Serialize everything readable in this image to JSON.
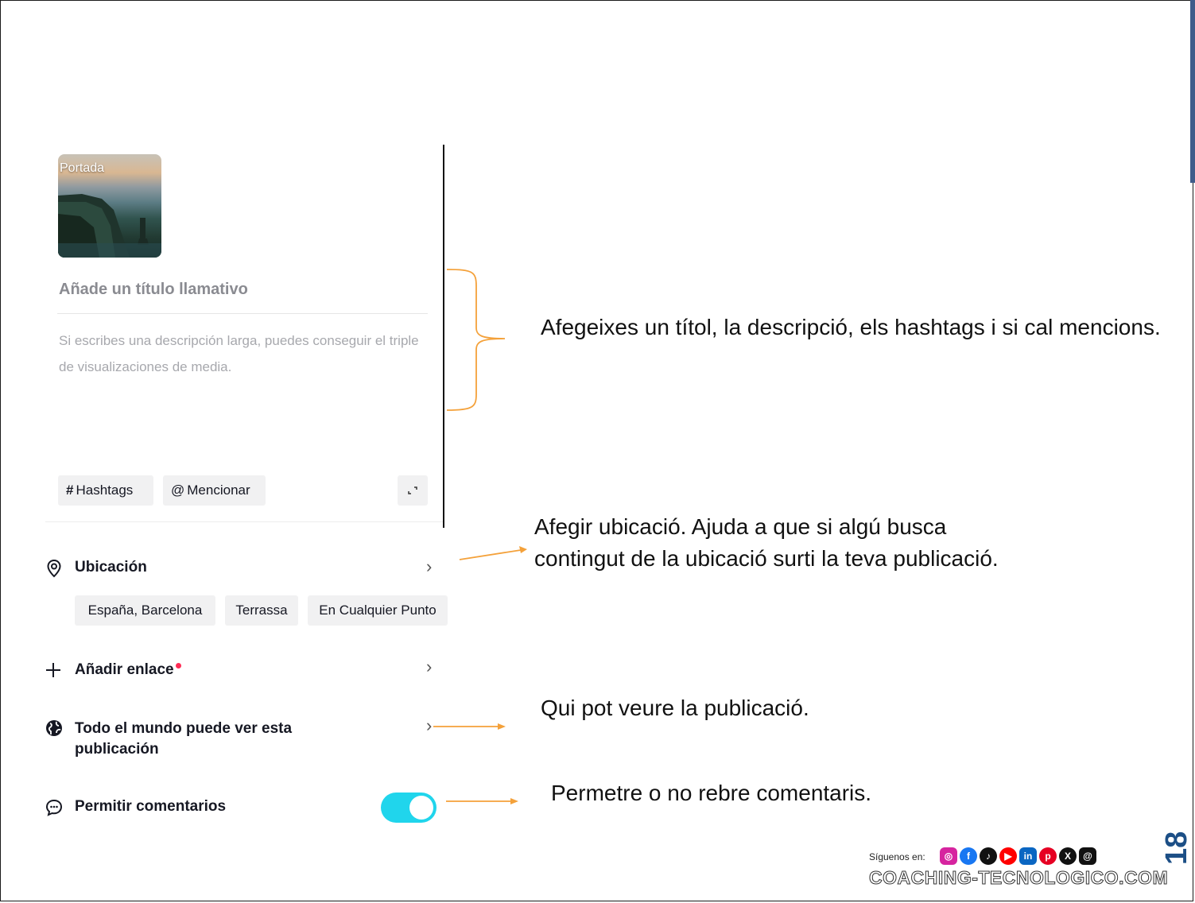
{
  "cover": {
    "label": "Portada"
  },
  "caption": {
    "title_placeholder": "Añade un título llamativo",
    "description_placeholder": "Si escribes una descripción larga, puedes conseguir el triple de visualizaciones de media."
  },
  "chips": {
    "hashtags": "Hashtags",
    "mention": "Mencionar"
  },
  "location": {
    "label": "Ubicación",
    "suggestions": [
      "España, Barcelona",
      "Terrassa",
      "En Cualquier Punto"
    ]
  },
  "link": {
    "label": "Añadir enlace"
  },
  "privacy": {
    "label_line1": "Todo el mundo puede ver esta",
    "label_line2": "publicación"
  },
  "comments": {
    "label": "Permitir comentarios",
    "enabled": true
  },
  "notes": {
    "caption": "Afegeixes un títol, la descripció, els hashtags i si cal mencions.",
    "location_line1": "Afegir ubicació. Ajuda a que si algú busca",
    "location_line2": "contingut de la ubicació surti la teva publicació.",
    "privacy": "Qui pot veure la publicació.",
    "comments": "Permetre o no rebre comentaris."
  },
  "footer": {
    "follow": "Síguenos en:",
    "site": "COACHING-TECNOLOGICO.COM",
    "page_number": "18"
  },
  "colors": {
    "toggle": "#20d5ec",
    "annotation": "#f4a13a",
    "badge": "#fe2c55",
    "page_number": "#1c4f86"
  }
}
